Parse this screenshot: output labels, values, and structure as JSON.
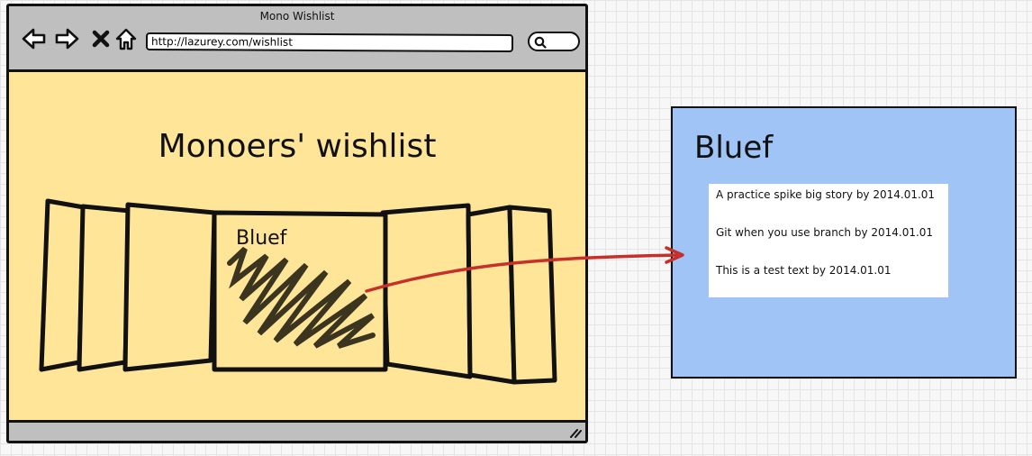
{
  "window": {
    "title": "Mono Wishlist",
    "url": "http://lazurey.com/wishlist"
  },
  "icons": {
    "back": "arrow-left-icon",
    "forward": "arrow-right-icon",
    "close": "close-icon",
    "home": "home-icon",
    "search": "search-icon",
    "resize": "resize-grip-icon"
  },
  "page": {
    "heading": "Monoers' wishlist",
    "focused_card_label": "Bluef"
  },
  "detail": {
    "title": "Bluef",
    "items": [
      "A practice spike big story by 2014.01.01",
      "Git when you use branch by 2014.01.01",
      "This is a test text by 2014.01.01"
    ]
  },
  "colors": {
    "page_background": "#ffe597",
    "chrome": "#bfbfbf",
    "detail_panel": "#a1c4f7",
    "connector": "#c7302a",
    "scribble": "#3b3520"
  }
}
